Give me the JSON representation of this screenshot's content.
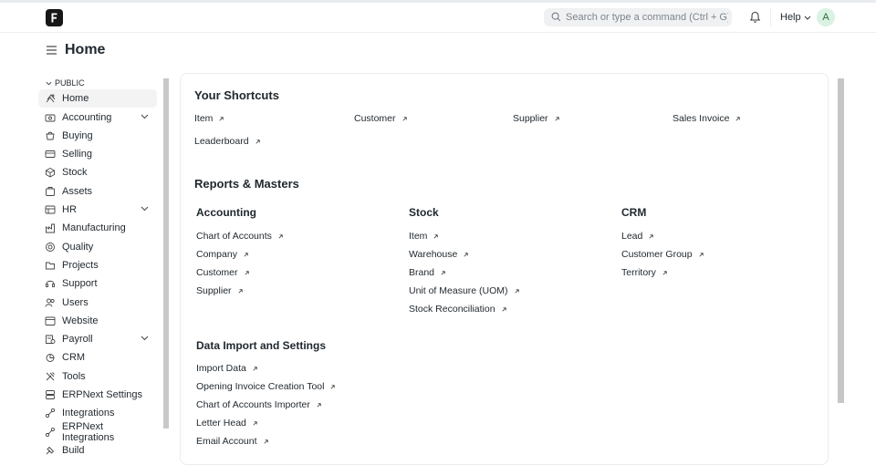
{
  "navbar": {
    "search_placeholder": "Search or type a command (Ctrl + G)",
    "help_label": "Help",
    "avatar_initial": "A"
  },
  "page": {
    "title": "Home"
  },
  "sidebar": {
    "group_label": "PUBLIC",
    "items": [
      {
        "label": "Home",
        "icon": "home-icon",
        "active": true
      },
      {
        "label": "Accounting",
        "icon": "accounting-icon",
        "expandable": true
      },
      {
        "label": "Buying",
        "icon": "buying-icon"
      },
      {
        "label": "Selling",
        "icon": "selling-icon"
      },
      {
        "label": "Stock",
        "icon": "stock-icon"
      },
      {
        "label": "Assets",
        "icon": "assets-icon"
      },
      {
        "label": "HR",
        "icon": "hr-icon",
        "expandable": true
      },
      {
        "label": "Manufacturing",
        "icon": "manufacturing-icon"
      },
      {
        "label": "Quality",
        "icon": "quality-icon"
      },
      {
        "label": "Projects",
        "icon": "projects-icon"
      },
      {
        "label": "Support",
        "icon": "support-icon"
      },
      {
        "label": "Users",
        "icon": "users-icon"
      },
      {
        "label": "Website",
        "icon": "website-icon"
      },
      {
        "label": "Payroll",
        "icon": "payroll-icon",
        "expandable": true
      },
      {
        "label": "CRM",
        "icon": "crm-icon"
      },
      {
        "label": "Tools",
        "icon": "tools-icon"
      },
      {
        "label": "ERPNext Settings",
        "icon": "settings-icon"
      },
      {
        "label": "Integrations",
        "icon": "integrations-icon"
      },
      {
        "label": "ERPNext Integrations",
        "icon": "integrations-icon"
      },
      {
        "label": "Build",
        "icon": "build-icon"
      }
    ]
  },
  "shortcuts": {
    "title": "Your Shortcuts",
    "items": [
      "Item",
      "Customer",
      "Supplier",
      "Sales Invoice",
      "Leaderboard"
    ]
  },
  "reports": {
    "title": "Reports & Masters",
    "columns": [
      {
        "title": "Accounting",
        "links": [
          "Chart of Accounts",
          "Company",
          "Customer",
          "Supplier"
        ]
      },
      {
        "title": "Stock",
        "links": [
          "Item",
          "Warehouse",
          "Brand",
          "Unit of Measure (UOM)",
          "Stock Reconciliation"
        ]
      },
      {
        "title": "CRM",
        "links": [
          "Lead",
          "Customer Group",
          "Territory"
        ]
      }
    ],
    "data_import": {
      "title": "Data Import and Settings",
      "links": [
        "Import Data",
        "Opening Invoice Creation Tool",
        "Chart of Accounts Importer",
        "Letter Head",
        "Email Account"
      ]
    }
  }
}
